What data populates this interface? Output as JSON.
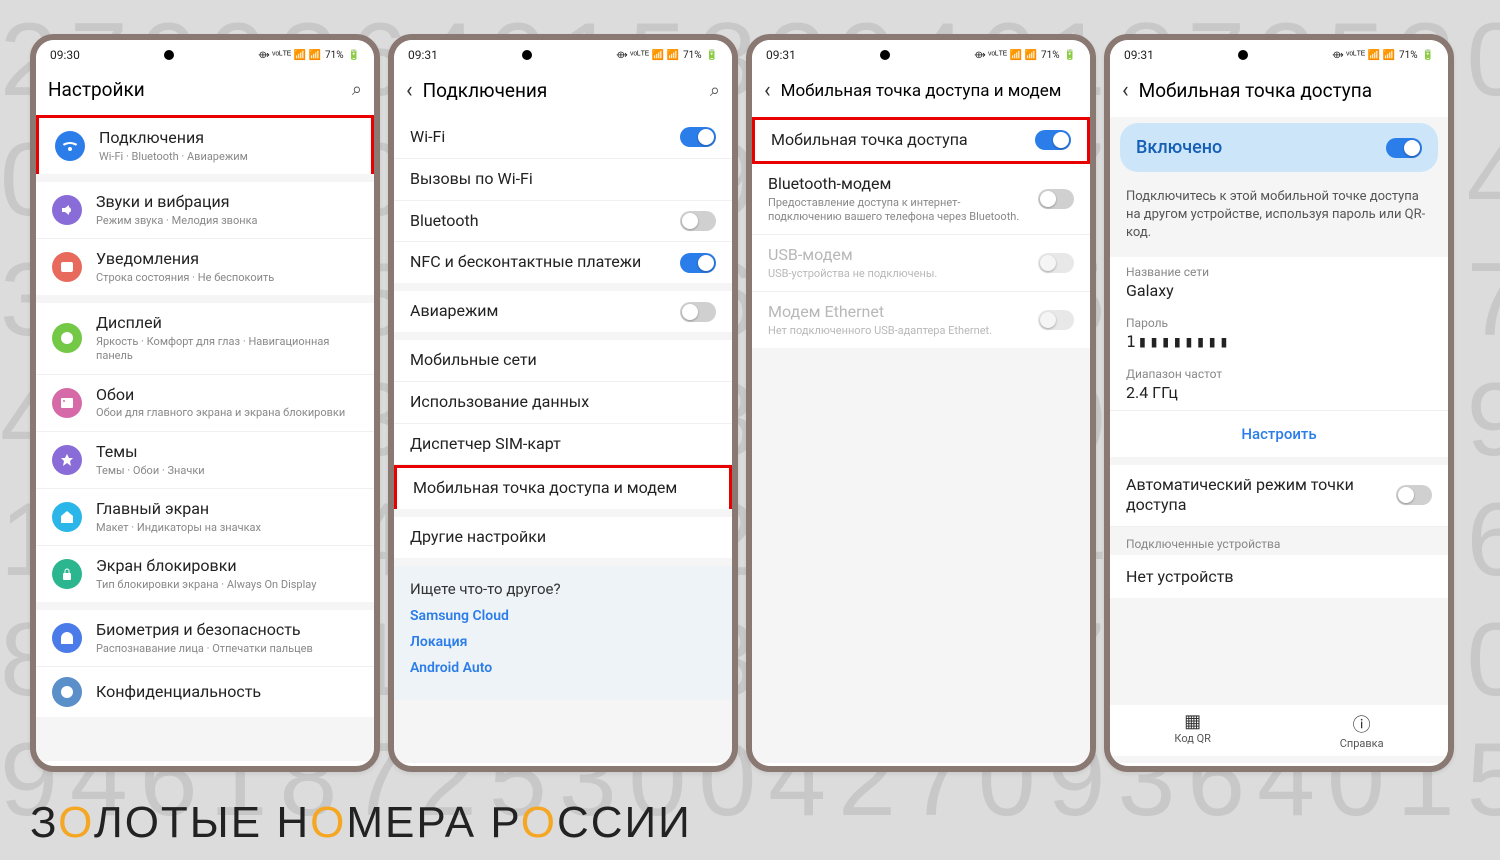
{
  "status": {
    "time1": "09:30",
    "time2": "09:31",
    "battery": "71%"
  },
  "brand": {
    "p1": "З",
    "p2": "О",
    "p3": "ЛОТЫЕ Н",
    "p4": "О",
    "p5": "МЕРА Р",
    "p6": "О",
    "p7": "ССИИ"
  },
  "s1": {
    "title": "Настройки",
    "items": [
      {
        "title": "Подключения",
        "sub": "Wi-Fi · Bluetooth · Авиарежим",
        "color": "#2b7de9",
        "kind": "wifi",
        "hl": true
      },
      {
        "title": "Звуки и вибрация",
        "sub": "Режим звука · Мелодия звонка",
        "color": "#8a6cd9",
        "kind": "sound"
      },
      {
        "title": "Уведомления",
        "sub": "Строка состояния · Не беспокоить",
        "color": "#e86a5d",
        "kind": "notif"
      },
      {
        "title": "Дисплей",
        "sub": "Яркость · Комфорт для глаз · Навигационная панель",
        "color": "#73c946",
        "kind": "display"
      },
      {
        "title": "Обои",
        "sub": "Обои для главного экрана и экрана блокировки",
        "color": "#d66aa8",
        "kind": "wall"
      },
      {
        "title": "Темы",
        "sub": "Темы · Обои · Значки",
        "color": "#8a6cd9",
        "kind": "themes"
      },
      {
        "title": "Главный экран",
        "sub": "Макет · Индикаторы на значках",
        "color": "#2bb6e9",
        "kind": "home"
      },
      {
        "title": "Экран блокировки",
        "sub": "Тип блокировки экрана · Always On Display",
        "color": "#2bb690",
        "kind": "lock"
      },
      {
        "title": "Биометрия и безопасность",
        "sub": "Распознавание лица · Отпечатки пальцев",
        "color": "#4a7be9",
        "kind": "bio"
      },
      {
        "title": "Конфиденциальность",
        "sub": "",
        "color": "#5a8fc9",
        "kind": "priv"
      }
    ]
  },
  "s2": {
    "title": "Подключения",
    "items": [
      {
        "title": "Wi-Fi",
        "toggle": "on"
      },
      {
        "title": "Вызовы по Wi-Fi"
      },
      {
        "title": "Bluetooth",
        "toggle": "off"
      },
      {
        "title": "NFC и бесконтактные платежи",
        "toggle": "on"
      },
      {
        "title": "Авиарежим",
        "toggle": "off",
        "gap": true
      },
      {
        "title": "Мобильные сети",
        "gap": true
      },
      {
        "title": "Использование данных"
      },
      {
        "title": "Диспетчер SIM-карт"
      },
      {
        "title": "Мобильная точка доступа и модем",
        "hl": true
      },
      {
        "title": "Другие настройки",
        "gap": true
      }
    ],
    "looking": {
      "q": "Ищете что-то другое?",
      "links": [
        "Samsung Cloud",
        "Локация",
        "Android Auto"
      ]
    }
  },
  "s3": {
    "title": "Мобильная точка доступа и модем",
    "items": [
      {
        "title": "Мобильная точка доступа",
        "toggle": "on",
        "hl": true
      },
      {
        "title": "Bluetooth-модем",
        "sub": "Предоставление доступа к интернет-подключению вашего телефона через Bluetooth.",
        "toggle": "off"
      },
      {
        "title": "USB-модем",
        "sub": "USB-устройства не подключены.",
        "toggle": "disabled",
        "disabled": true
      },
      {
        "title": "Модем Ethernet",
        "sub": "Нет подключенного USB-адаптера Ethernet.",
        "toggle": "disabled",
        "disabled": true
      }
    ]
  },
  "s4": {
    "title": "Мобильная точка доступа",
    "enabled": "Включено",
    "note": "Подключитесь к этой мобильной точке доступа на другом устройстве, используя пароль или QR-код.",
    "netLabel": "Название сети",
    "netValue": "Galaxy",
    "passLabel": "Пароль",
    "passValue": "1▮▮▮▮▮▮▮▮",
    "bandLabel": "Диапазон частот",
    "bandValue": "2.4 ГГц",
    "configure": "Настроить",
    "autoLabel": "Автоматический режим точки доступа",
    "connected": "Подключенные устройства",
    "noDevices": "Нет устройств",
    "qr": "Код QR",
    "help": "Справка"
  }
}
